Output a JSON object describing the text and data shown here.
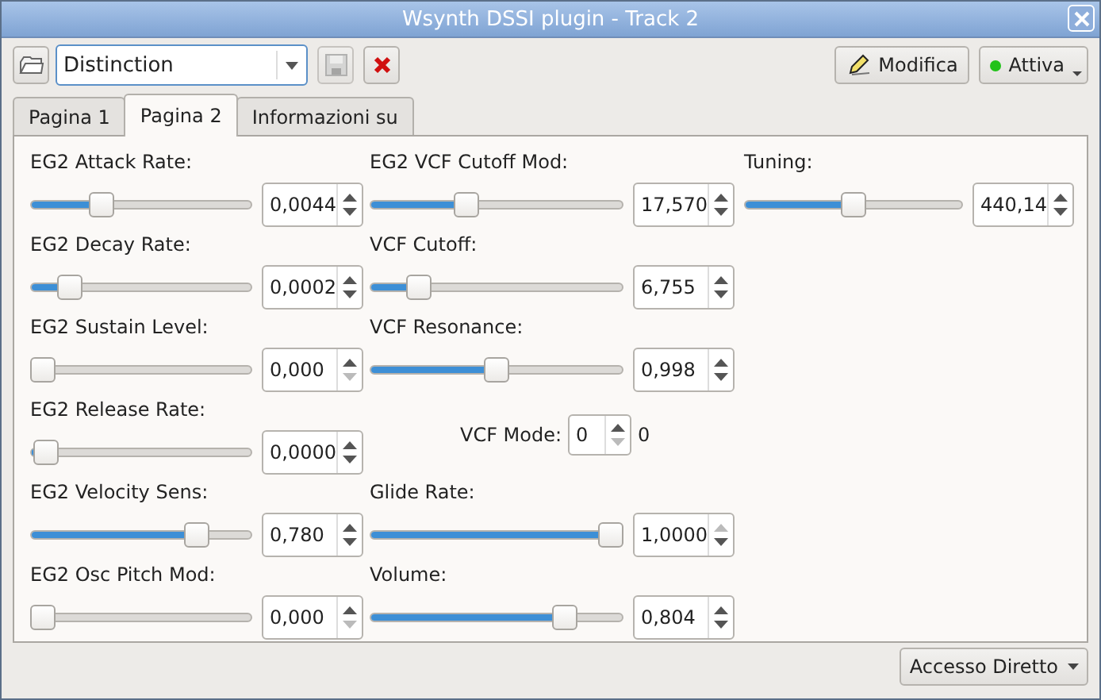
{
  "window": {
    "title": "Wsynth DSSI plugin - Track 2"
  },
  "toolbar": {
    "preset": "Distinction",
    "save_button": {
      "disabled": true
    },
    "edit_button": "Modifica",
    "active_button": {
      "label": "Attiva",
      "on": true
    }
  },
  "tabs": [
    {
      "label": "Pagina 1",
      "selected": false
    },
    {
      "label": "Pagina 2",
      "selected": true
    },
    {
      "label": "Informazioni su",
      "selected": false
    }
  ],
  "columns": [
    {
      "items": [
        {
          "kind": "slider",
          "label": "EG2 Attack Rate:",
          "level": 0.3,
          "value": "0,0044",
          "up_disabled": false,
          "down_disabled": false
        },
        {
          "kind": "slider",
          "label": "EG2 Decay Rate:",
          "level": 0.14,
          "value": "0,0002",
          "up_disabled": false,
          "down_disabled": false
        },
        {
          "kind": "slider",
          "label": "EG2 Sustain Level:",
          "level": 0.0,
          "value": "0,000",
          "up_disabled": false,
          "down_disabled": true
        },
        {
          "kind": "slider",
          "label": "EG2 Release Rate:",
          "level": 0.02,
          "value": "0,0000",
          "up_disabled": false,
          "down_disabled": false
        },
        {
          "kind": "slider",
          "label": "EG2 Velocity Sens:",
          "level": 0.78,
          "value": "0,780",
          "up_disabled": false,
          "down_disabled": false
        },
        {
          "kind": "slider",
          "label": "EG2 Osc Pitch Mod:",
          "level": 0.0,
          "value": "0,000",
          "up_disabled": false,
          "down_disabled": true
        }
      ]
    },
    {
      "items": [
        {
          "kind": "slider",
          "label": "EG2 VCF Cutoff Mod:",
          "level": 0.37,
          "value": "17,570",
          "up_disabled": false,
          "down_disabled": false
        },
        {
          "kind": "slider",
          "label": "VCF Cutoff:",
          "level": 0.16,
          "value": "6,755",
          "up_disabled": false,
          "down_disabled": false
        },
        {
          "kind": "slider",
          "label": "VCF Resonance:",
          "level": 0.5,
          "value": "0,998",
          "up_disabled": false,
          "down_disabled": false
        },
        {
          "kind": "spin",
          "label": "VCF Mode:",
          "value": "0",
          "reading": "0",
          "up_disabled": false,
          "down_disabled": true
        },
        {
          "kind": "slider",
          "label": "Glide Rate:",
          "level": 1.0,
          "value": "1,0000",
          "up_disabled": true,
          "down_disabled": false
        },
        {
          "kind": "slider",
          "label": "Volume:",
          "level": 0.8,
          "value": "0,804",
          "up_disabled": false,
          "down_disabled": false
        }
      ]
    },
    {
      "items": [
        {
          "kind": "slider",
          "label": "Tuning:",
          "level": 0.5,
          "value": "440,14",
          "up_disabled": false,
          "down_disabled": false
        }
      ]
    }
  ],
  "footer_button": "Accesso Diretto"
}
